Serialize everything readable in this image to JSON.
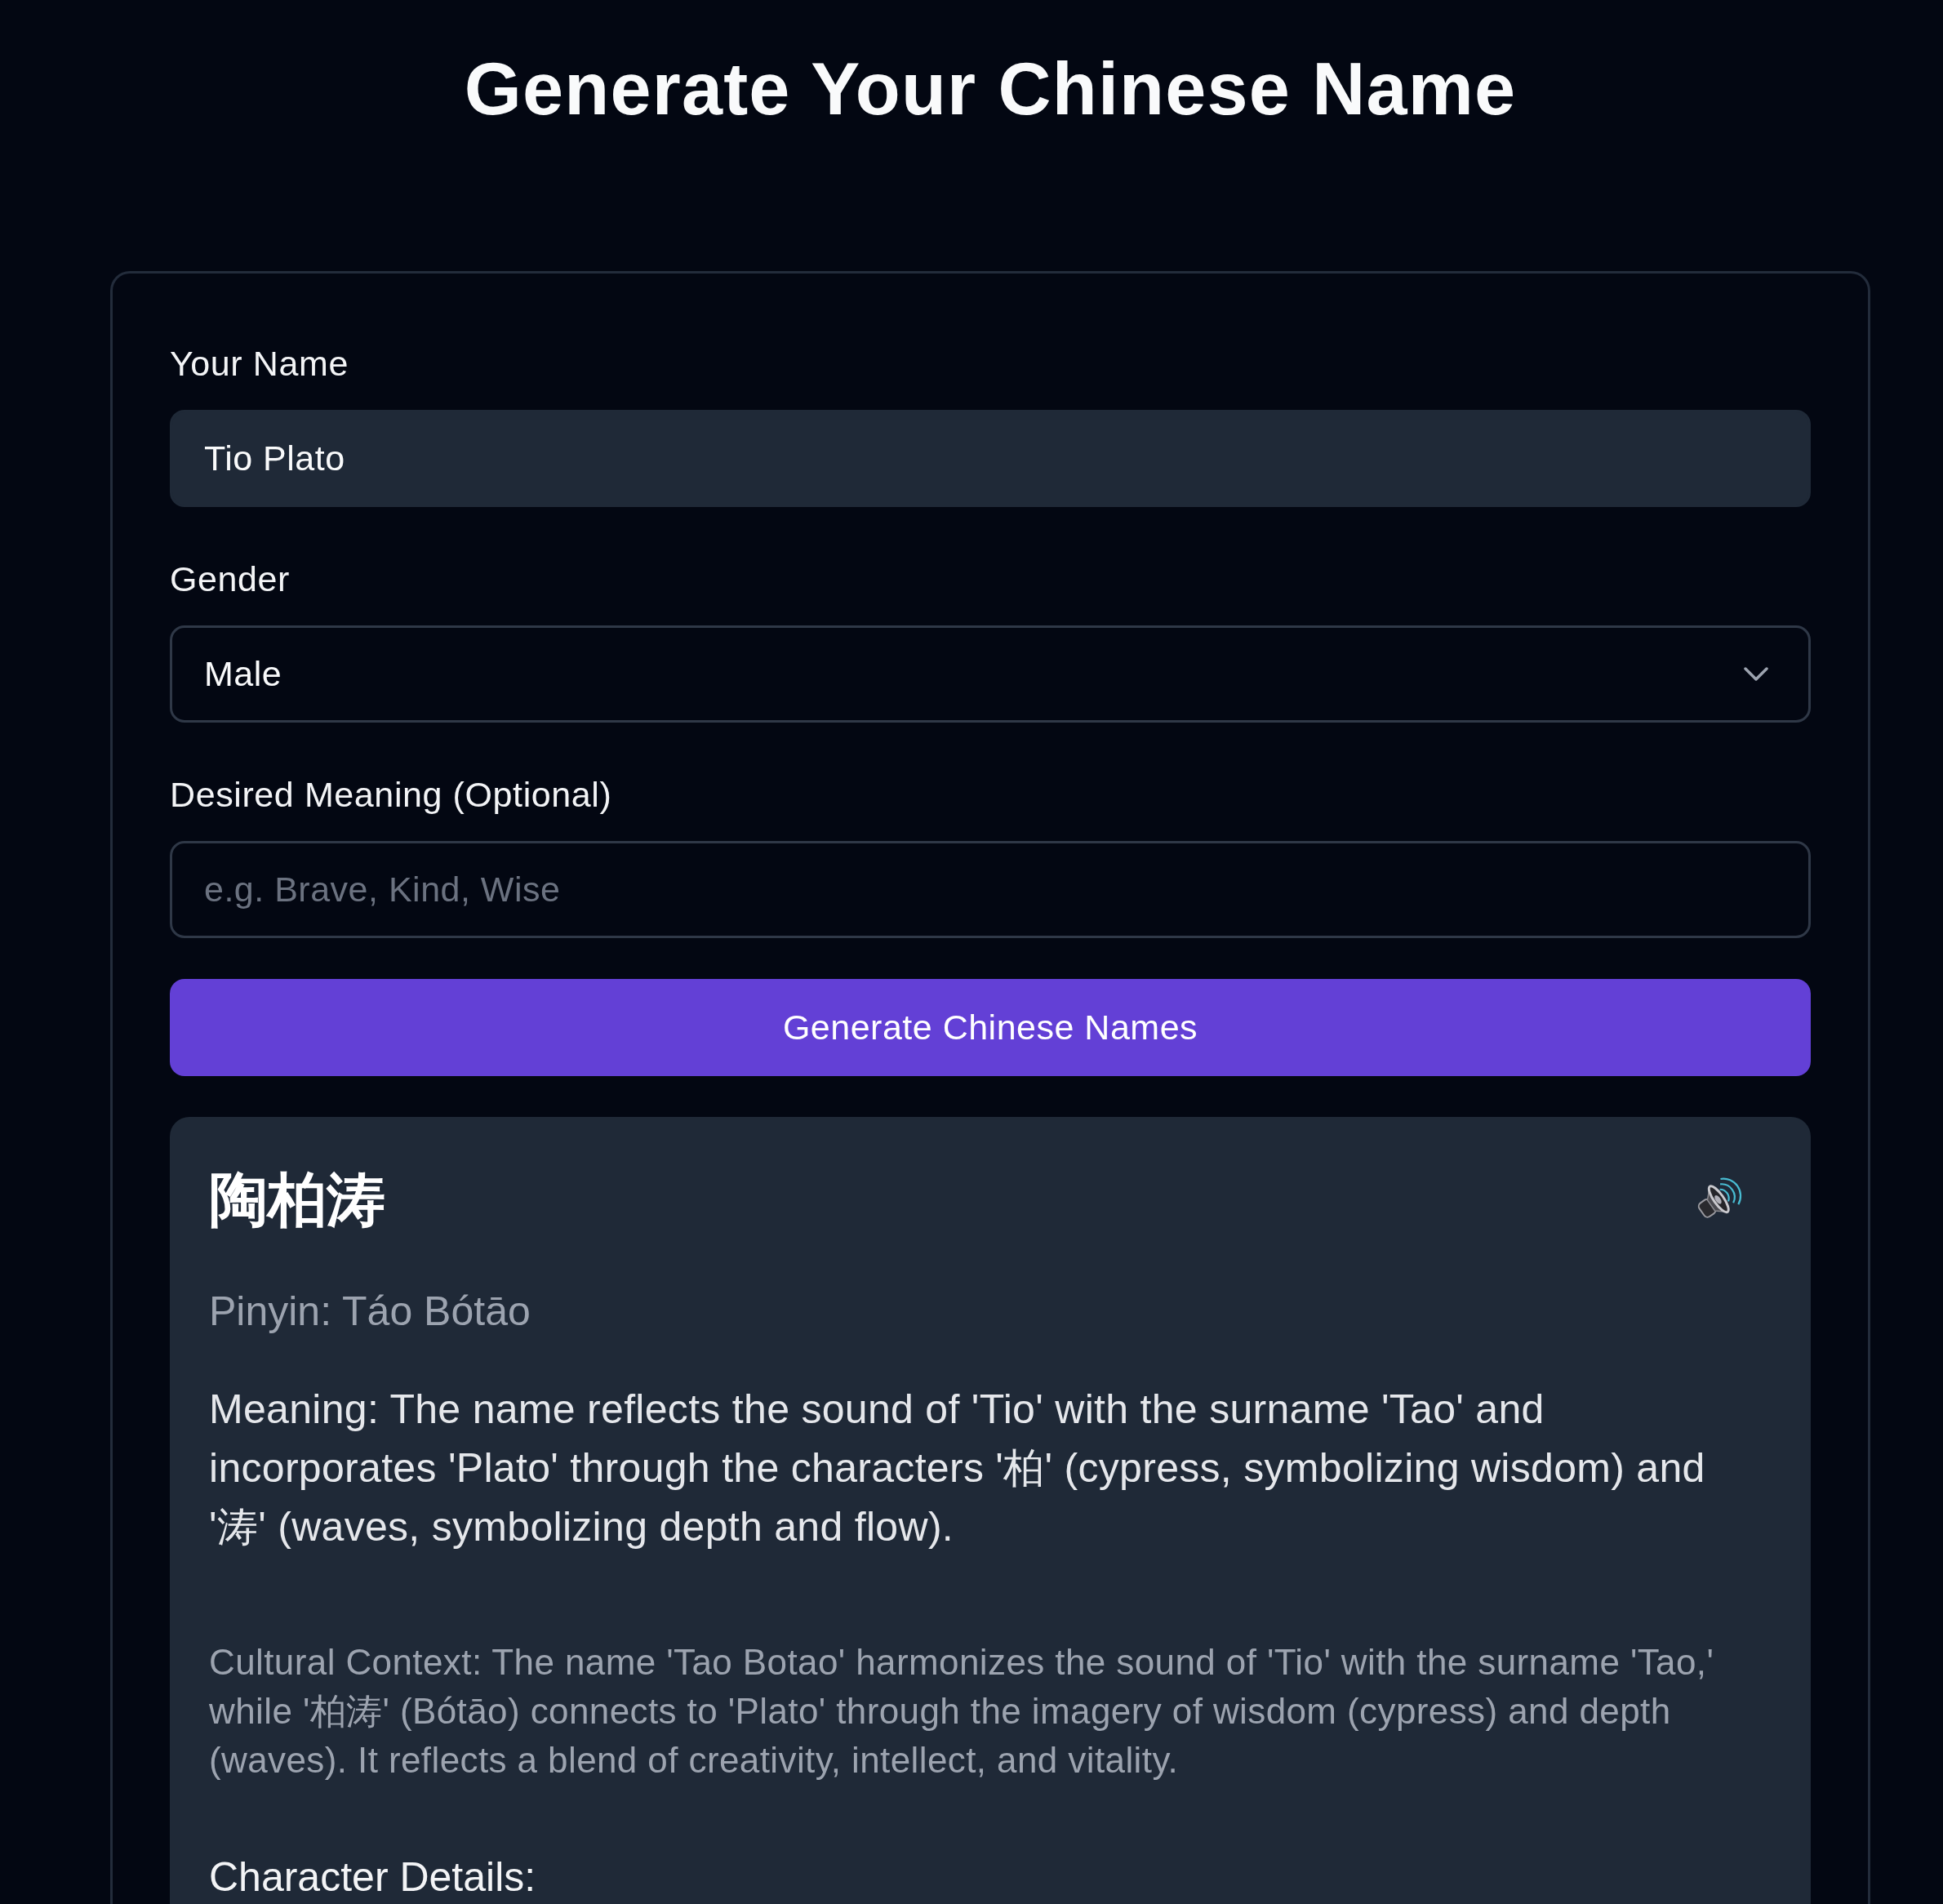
{
  "page": {
    "title": "Generate Your Chinese Name"
  },
  "form": {
    "fields": [
      {
        "kind": "text",
        "label": "Your Name",
        "value": "Tio Plato",
        "autofilled": true
      },
      {
        "kind": "select",
        "label": "Gender",
        "value": "Male",
        "autofilled": false
      },
      {
        "kind": "text",
        "label": "Desired Meaning (Optional)",
        "placeholder": "e.g. Brave, Kind, Wise",
        "autofilled": false
      }
    ],
    "submit": {
      "label": "Generate Chinese Names"
    }
  },
  "result": {
    "name": "陶柏涛",
    "pinyin": "Pinyin: Táo Bótāo",
    "meaning": "Meaning: The name reflects the sound of 'Tio' with the surname 'Tao' and incorporates 'Plato' through the characters '柏' (cypress, symbolizing wisdom) and '涛' (waves, symbolizing depth and flow).",
    "cultural_context": "Cultural Context: The name 'Tao Botao' harmonizes the sound of 'Tio' with the surname 'Tao,' while '柏涛' (Bótāo) connects to 'Plato' through the imagery of wisdom (cypress) and depth (waves). It reflects a blend of creativity, intellect, and vitality.",
    "details_heading": "Character Details:"
  }
}
